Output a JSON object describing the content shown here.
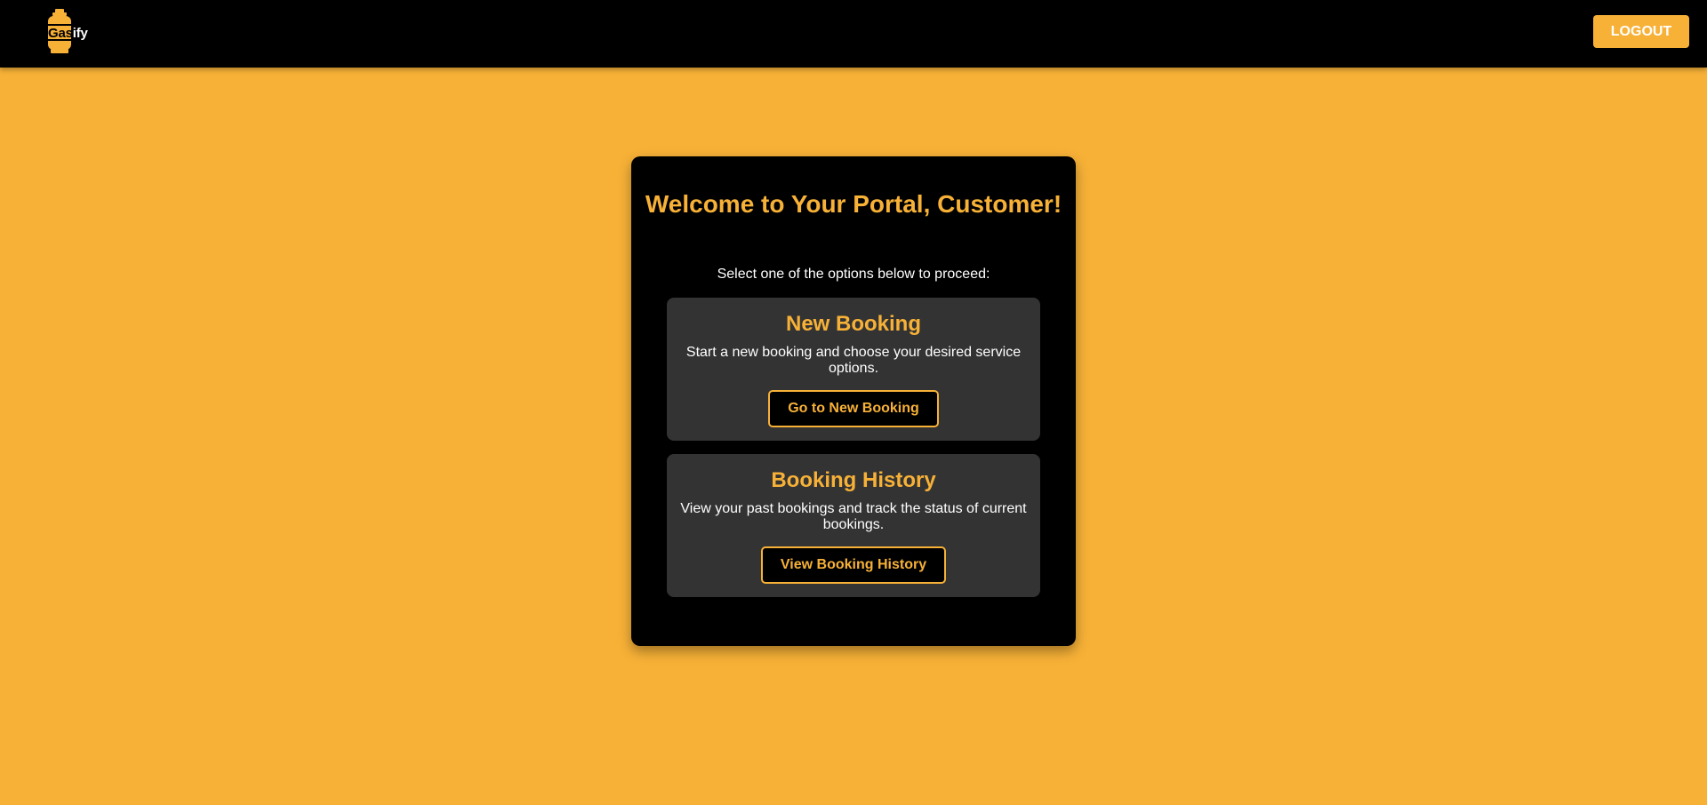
{
  "brand": {
    "logo_prefix": "Gas",
    "logo_suffix": "ify",
    "icon": "gas-cylinder-icon"
  },
  "navbar": {
    "logout_label": "LOGOUT"
  },
  "portal": {
    "title": "Welcome to Your Portal, Customer!",
    "subtitle": "Select one of the options below to proceed:",
    "options": [
      {
        "title": "New Booking",
        "description": "Start a new booking and choose your desired service options.",
        "button_label": "Go to New Booking"
      },
      {
        "title": "Booking History",
        "description": "View your past bookings and track the status of current bookings.",
        "button_label": "View Booking History"
      }
    ]
  },
  "colors": {
    "accent": "#F7B137",
    "background": "#F7B137",
    "card": "#000000",
    "option_card": "#333333",
    "text_light": "#FFFFFF"
  }
}
